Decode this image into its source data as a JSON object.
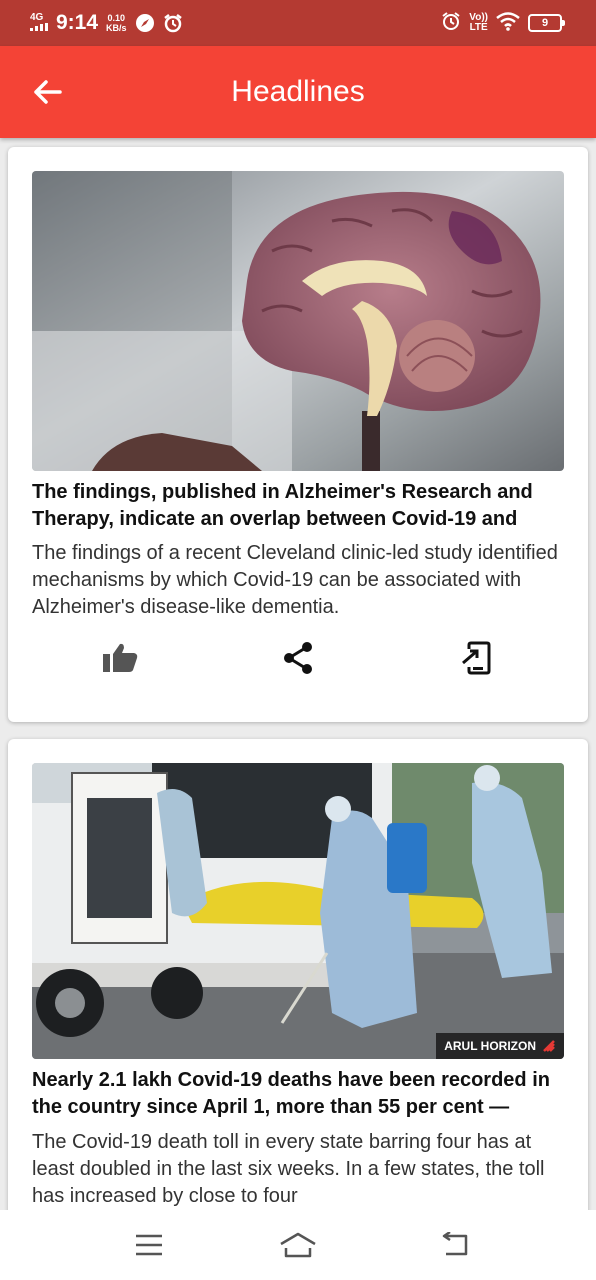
{
  "status_bar": {
    "network": "4G",
    "time": "9:14",
    "speed_value": "0.10",
    "speed_unit": "KB/s",
    "volte": "Vo))",
    "lte": "LTE",
    "battery": "9"
  },
  "app_bar": {
    "title": "Headlines",
    "back_icon": "arrow-left-icon"
  },
  "articles": [
    {
      "image": "brain-model-photo",
      "headline": "The findings, published in Alzheimer's Research and Therapy, indicate an overlap between Covid-19 and",
      "summary": "The findings of a recent Cleveland clinic-led study identified mechanisms by which Covid-19 can be associated with Alzheimer's disease-like dementia.",
      "actions": [
        "thumb-up-icon",
        "share-icon",
        "open-external-icon"
      ]
    },
    {
      "image": "health-workers-ambulance-photo",
      "image_credit": "ARUL HORIZON",
      "headline": "Nearly 2.1 lakh Covid-19 deaths have been recorded in the country since April 1, more than 55 per cent —",
      "summary": "The Covid-19 death toll in every state barring four has at least doubled in the last six weeks. In a few states, the toll has increased by close to four"
    }
  ],
  "nav_bar": {
    "icons": [
      "menu-icon",
      "home-icon",
      "back-icon"
    ]
  },
  "colors": {
    "app_bar": "#f44336",
    "status_bar": "#b43a32"
  }
}
